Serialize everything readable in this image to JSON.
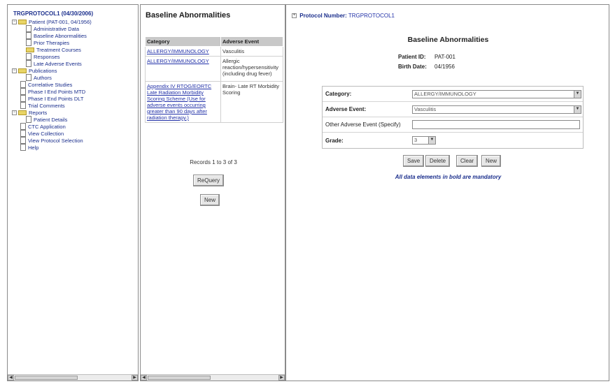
{
  "tree": {
    "title": "TRGPROTOCOL1 (04/30/2006)",
    "patient": "Patient (PAT-001, 04/1956)",
    "patient_items": [
      "Administrative Data",
      "Baseline Abnormalities",
      "Prior Therapies",
      "Treatment Courses",
      "Responses",
      "Late Adverse Events"
    ],
    "publications": "Publications",
    "authors": "Authors",
    "other_items": [
      "Correlative Studies",
      "Phase I End Points MTD",
      "Phase I End Points DLT",
      "Trial Comments"
    ],
    "reports": "Reports",
    "patient_details": "Patient Details",
    "bottom_items": [
      "CTC Application",
      "View Collection",
      "View Protocol Selection",
      "Help"
    ]
  },
  "list": {
    "title": "Baseline Abnormalities",
    "headers": [
      "Category",
      "Adverse Event"
    ],
    "rows": [
      {
        "category": "ALLERGY/IMMUNOLOGY",
        "event": "Vasculitis"
      },
      {
        "category": "ALLERGY/IMMUNOLOGY",
        "event": "Allergic reaction/hypersensitivity (including drug fever)"
      },
      {
        "category": "Appendix IV RTOG/EORTC Late Radiation Morbidity Scoring Scheme (Use for adverse events occurring greater than 90 days after radiation therapy.)",
        "event": "Brain- Late RT Morbidity Scoring"
      }
    ],
    "records_text": "Records 1 to 3 of 3",
    "requery_label": "ReQuery",
    "new_label": "New"
  },
  "detail": {
    "protocol_label": "Protocol Number:",
    "protocol_value": "TRGPROTOCOL1",
    "title": "Baseline Abnormalities",
    "patient_id_label": "Patient ID:",
    "patient_id": "PAT-001",
    "birth_date_label": "Birth Date:",
    "birth_date": "04/1956",
    "category_label": "Category:",
    "category_value": "ALLERGY/IMMUNOLOGY",
    "adverse_event_label": "Adverse Event:",
    "adverse_event_value": "Vasculitis",
    "other_label": "Other Adverse Event (Specify)",
    "grade_label": "Grade:",
    "grade_value": "3",
    "save_label": "Save",
    "delete_label": "Delete",
    "clear_label": "Clear",
    "new_label": "New",
    "mandatory_note": "All data elements in bold are mandatory"
  },
  "colors": {
    "link": "#2231a8",
    "title_blue": "#1a2e8c",
    "header_gray": "#c8c8c8"
  }
}
